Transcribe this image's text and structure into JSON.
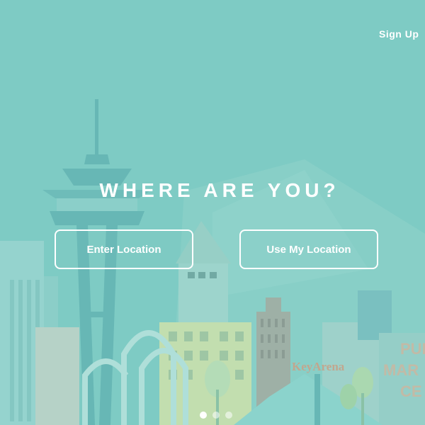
{
  "header": {
    "signup_label": "Sign Up"
  },
  "main": {
    "heading": "WHERE ARE YOU?",
    "enter_location_label": "Enter Location",
    "use_my_location_label": "Use My Location"
  },
  "carousel": {
    "page_count": 3,
    "active_index": 0
  },
  "scene": {
    "landmark_signs": {
      "keyarena": "KeyArena",
      "public_market_line1": "PUI",
      "public_market_line2": "MAR",
      "public_market_line3": "CE"
    }
  },
  "colors": {
    "background": "#7ecbc4",
    "text": "#ffffff"
  }
}
